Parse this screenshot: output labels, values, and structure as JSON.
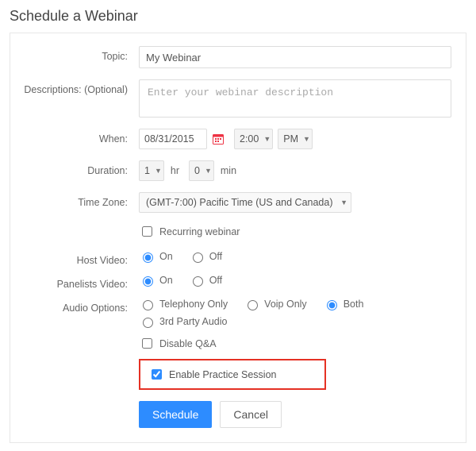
{
  "page_title": "Schedule a Webinar",
  "labels": {
    "topic": "Topic:",
    "descriptions": "Descriptions: (Optional)",
    "when": "When:",
    "duration": "Duration:",
    "timezone": "Time Zone:",
    "host_video": "Host Video:",
    "panelists_video": "Panelists Video:",
    "audio_options": "Audio Options:"
  },
  "topic_value": "My Webinar",
  "description_placeholder": "Enter your webinar description",
  "when": {
    "date": "08/31/2015",
    "time": "2:00",
    "meridiem": "PM"
  },
  "duration": {
    "hours": "1",
    "hr_label": "hr",
    "minutes": "0",
    "min_label": "min"
  },
  "timezone_value": "(GMT-7:00) Pacific Time (US and Canada)",
  "recurring_label": "Recurring webinar",
  "on_label": "On",
  "off_label": "Off",
  "audio": {
    "telephony": "Telephony Only",
    "voip": "Voip Only",
    "both": "Both",
    "third_party": "3rd Party Audio"
  },
  "disable_qa_label": "Disable Q&A",
  "enable_practice_label": "Enable Practice Session",
  "buttons": {
    "schedule": "Schedule",
    "cancel": "Cancel"
  }
}
